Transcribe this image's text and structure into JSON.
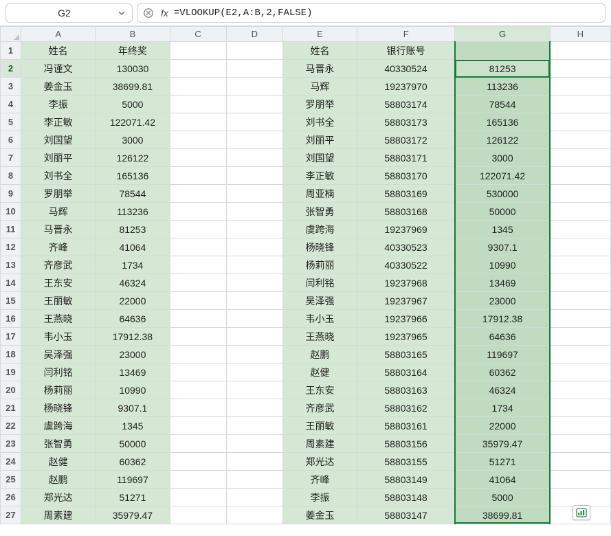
{
  "namebox": {
    "value": "G2"
  },
  "formula_bar": {
    "cancel_icon": "cancel",
    "fx_label": "fx",
    "value": "=VLOOKUP(E2,A:B,2,FALSE)"
  },
  "columns": [
    "A",
    "B",
    "C",
    "D",
    "E",
    "F",
    "G",
    "H"
  ],
  "row_count": 27,
  "selected_col": "G",
  "selected_row": 2,
  "headers_row1": {
    "A": "姓名",
    "B": "年终奖",
    "E": "姓名",
    "F": "银行账号"
  },
  "table_ab": [
    {
      "name": "冯谨文",
      "bonus": "130030"
    },
    {
      "name": "姜金玉",
      "bonus": "38699.81"
    },
    {
      "name": "李振",
      "bonus": "5000"
    },
    {
      "name": "李正敏",
      "bonus": "122071.42"
    },
    {
      "name": "刘国望",
      "bonus": "3000"
    },
    {
      "name": "刘丽平",
      "bonus": "126122"
    },
    {
      "name": "刘书全",
      "bonus": "165136"
    },
    {
      "name": "罗朋举",
      "bonus": "78544"
    },
    {
      "name": "马辉",
      "bonus": "113236"
    },
    {
      "name": "马晋永",
      "bonus": "81253"
    },
    {
      "name": "齐峰",
      "bonus": "41064"
    },
    {
      "name": "齐彦武",
      "bonus": "1734"
    },
    {
      "name": "王东安",
      "bonus": "46324"
    },
    {
      "name": "王丽敏",
      "bonus": "22000"
    },
    {
      "name": "王燕晓",
      "bonus": "64636"
    },
    {
      "name": "韦小玉",
      "bonus": "17912.38"
    },
    {
      "name": "吴泽强",
      "bonus": "23000"
    },
    {
      "name": "闫利铭",
      "bonus": "13469"
    },
    {
      "name": "杨莉丽",
      "bonus": "10990"
    },
    {
      "name": "杨晓锋",
      "bonus": "9307.1"
    },
    {
      "name": "虞跨海",
      "bonus": "1345"
    },
    {
      "name": "张智勇",
      "bonus": "50000"
    },
    {
      "name": "赵健",
      "bonus": "60362"
    },
    {
      "name": "赵鹏",
      "bonus": "119697"
    },
    {
      "name": "郑光达",
      "bonus": "51271"
    },
    {
      "name": "周素建",
      "bonus": "35979.47"
    }
  ],
  "table_efg": [
    {
      "name": "马晋永",
      "acct": "40330524",
      "look": "81253"
    },
    {
      "name": "马辉",
      "acct": "19237970",
      "look": "113236"
    },
    {
      "name": "罗朋举",
      "acct": "58803174",
      "look": "78544"
    },
    {
      "name": "刘书全",
      "acct": "58803173",
      "look": "165136"
    },
    {
      "name": "刘丽平",
      "acct": "58803172",
      "look": "126122"
    },
    {
      "name": "刘国望",
      "acct": "58803171",
      "look": "3000"
    },
    {
      "name": "李正敏",
      "acct": "58803170",
      "look": "122071.42"
    },
    {
      "name": "周亚楠",
      "acct": "58803169",
      "look": "530000"
    },
    {
      "name": "张智勇",
      "acct": "58803168",
      "look": "50000"
    },
    {
      "name": "虞跨海",
      "acct": "19237969",
      "look": "1345"
    },
    {
      "name": "杨晓锋",
      "acct": "40330523",
      "look": "9307.1"
    },
    {
      "name": "杨莉丽",
      "acct": "40330522",
      "look": "10990"
    },
    {
      "name": "闫利铭",
      "acct": "19237968",
      "look": "13469"
    },
    {
      "name": "吴泽强",
      "acct": "19237967",
      "look": "23000"
    },
    {
      "name": "韦小玉",
      "acct": "19237966",
      "look": "17912.38"
    },
    {
      "name": "王燕晓",
      "acct": "19237965",
      "look": "64636"
    },
    {
      "name": "赵鹏",
      "acct": "58803165",
      "look": "119697"
    },
    {
      "name": "赵健",
      "acct": "58803164",
      "look": "60362"
    },
    {
      "name": "王东安",
      "acct": "58803163",
      "look": "46324"
    },
    {
      "name": "齐彦武",
      "acct": "58803162",
      "look": "1734"
    },
    {
      "name": "王丽敏",
      "acct": "58803161",
      "look": "22000"
    },
    {
      "name": "周素建",
      "acct": "58803156",
      "look": "35979.47"
    },
    {
      "name": "郑光达",
      "acct": "58803155",
      "look": "51271"
    },
    {
      "name": "齐峰",
      "acct": "58803149",
      "look": "41064"
    },
    {
      "name": "李振",
      "acct": "58803148",
      "look": "5000"
    },
    {
      "name": "姜金玉",
      "acct": "58803147",
      "look": "38699.81"
    }
  ],
  "qa_tooltip": "quick-analysis"
}
